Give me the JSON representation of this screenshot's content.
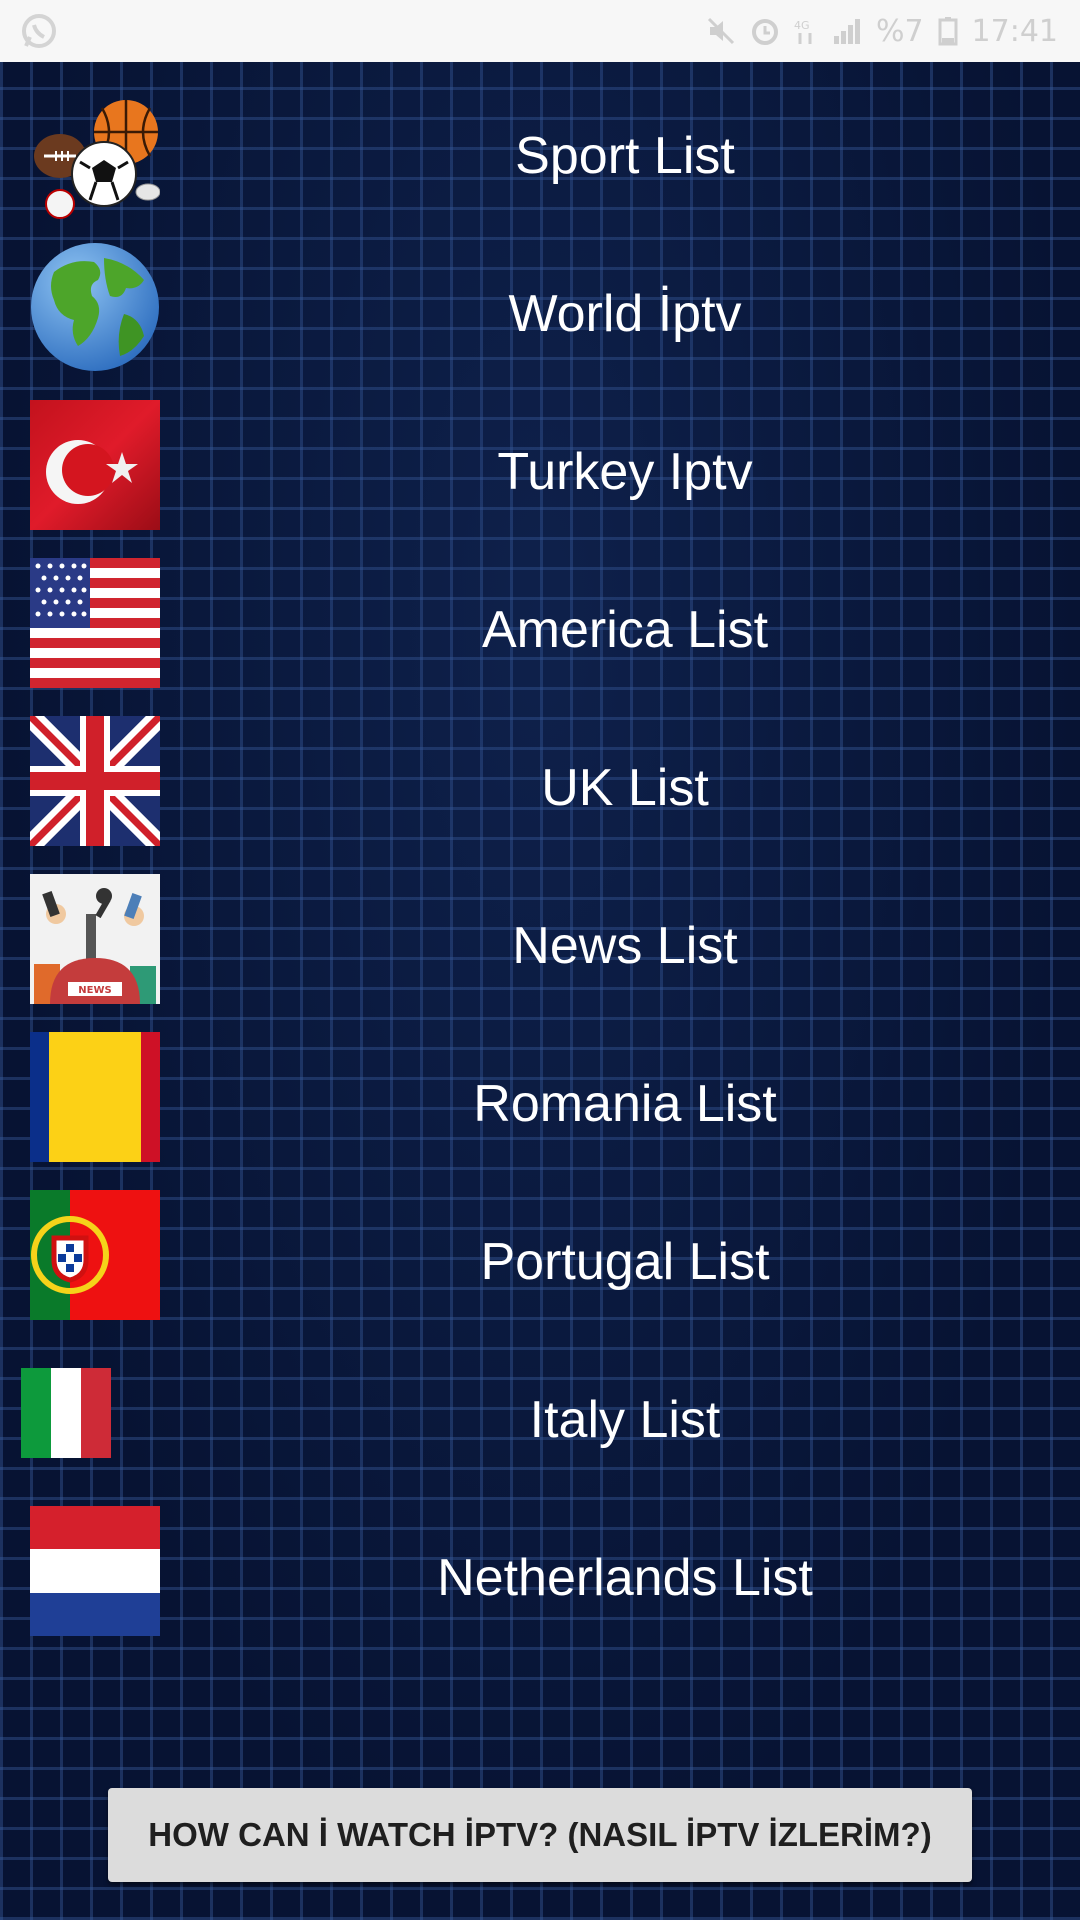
{
  "status_bar": {
    "battery": "%7",
    "time": "17:41"
  },
  "list": {
    "items": [
      {
        "label": "Sport List",
        "icon": "sports-balls-icon"
      },
      {
        "label": "World İptv",
        "icon": "globe-icon"
      },
      {
        "label": "Turkey Iptv",
        "icon": "turkey-flag-icon"
      },
      {
        "label": "America List",
        "icon": "usa-flag-icon"
      },
      {
        "label": "UK List",
        "icon": "uk-flag-icon"
      },
      {
        "label": "News List",
        "icon": "news-icon"
      },
      {
        "label": "Romania List",
        "icon": "romania-flag-icon"
      },
      {
        "label": "Portugal List",
        "icon": "portugal-flag-icon"
      },
      {
        "label": "Italy List",
        "icon": "italy-flag-icon"
      },
      {
        "label": "Netherlands List",
        "icon": "netherlands-flag-icon"
      }
    ]
  },
  "help_button": {
    "label": "HOW CAN İ WATCH İPTV? (NASIL İPTV İZLERİM?)"
  },
  "colors": {
    "background": "#071333",
    "button_bg": "#dcdcdc",
    "label_text": "#ffffff"
  }
}
